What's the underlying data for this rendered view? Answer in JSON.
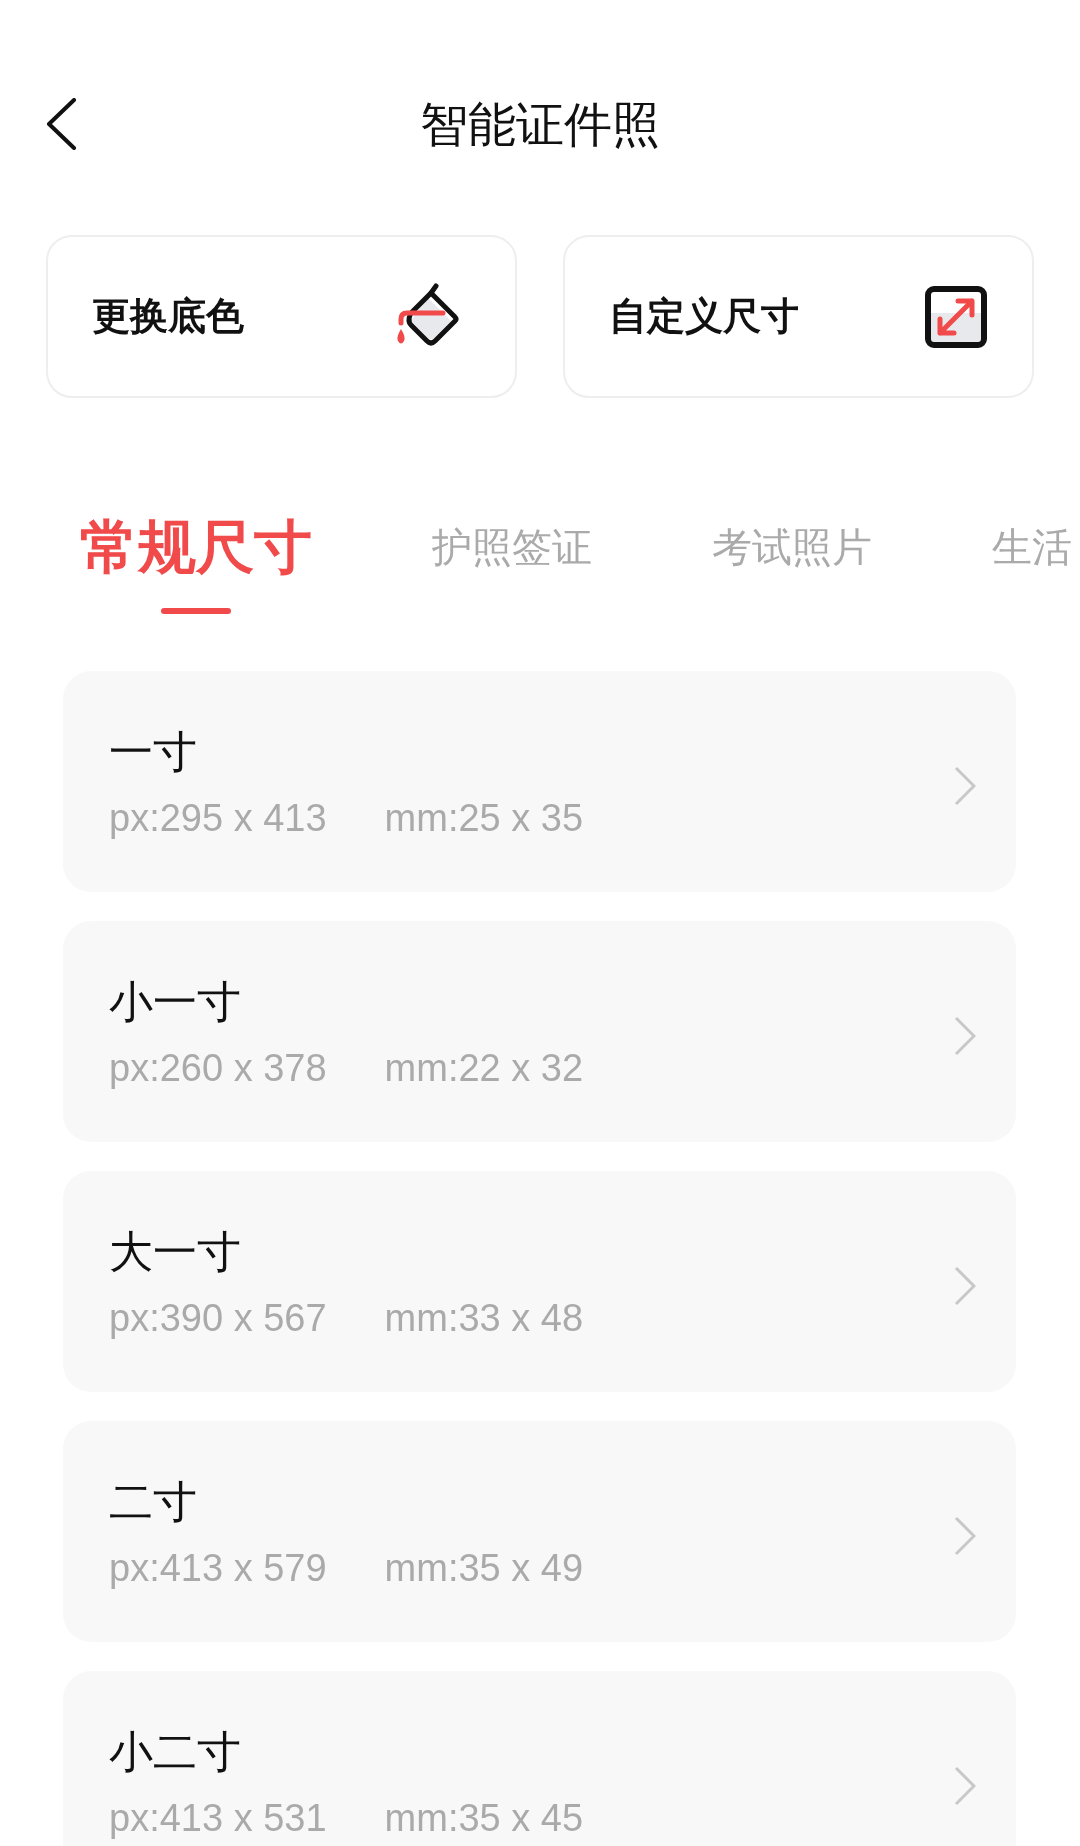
{
  "header": {
    "title": "智能证件照"
  },
  "actions": [
    {
      "kind": "paint",
      "label": "更换底色"
    },
    {
      "kind": "resize",
      "label": "自定义尺寸"
    }
  ],
  "tabs": [
    {
      "label": "常规尺寸",
      "selected": true
    },
    {
      "label": "护照签证",
      "selected": false
    },
    {
      "label": "考试照片",
      "selected": false
    },
    {
      "label": "生活",
      "selected": false
    }
  ],
  "sizes": [
    {
      "name": "一寸",
      "px": "px:295 x 413",
      "mm": "mm:25 x 35"
    },
    {
      "name": "小一寸",
      "px": "px:260 x 378",
      "mm": "mm:22 x 32"
    },
    {
      "name": "大一寸",
      "px": "px:390 x 567",
      "mm": "mm:33 x 48"
    },
    {
      "name": "二寸",
      "px": "px:413 x 579",
      "mm": "mm:35 x 49"
    },
    {
      "name": "小二寸",
      "px": "px:413 x 531",
      "mm": "mm:35 x 45"
    }
  ]
}
